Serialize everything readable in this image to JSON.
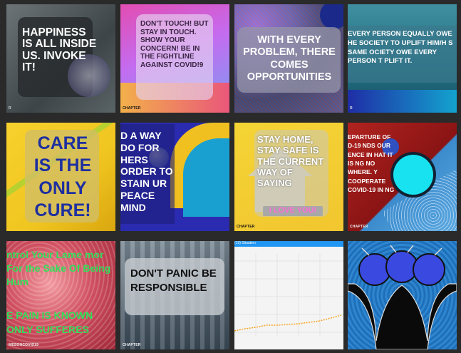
{
  "tiles": {
    "t1": {
      "text": "HAPPINESS IS ALL INSIDE US. INVOKE IT!",
      "footer": "R"
    },
    "t2": {
      "text": "DON'T TOUCH! BUT STAY IN TOUCH. SHOW YOUR CONCERN! BE IN THE FIGHTLINE AGAINST COVID!9",
      "footer": "CHAPTER"
    },
    "t3": {
      "text": "WITH EVERY PROBLEM, THERE COMES OPPORTUNITIES"
    },
    "t4": {
      "text": "EVERY PERSON EQUALLY OWE HE SOCIETY TO UPLIFT HIM/H S SAME OCIETY OWE EVERY PERSON T PLIFT IT.",
      "footer": "R"
    },
    "t5": {
      "text": "CARE IS THE ONLY CURE!"
    },
    "t6": {
      "text": "D A WAY DO FOR HERS ORDER TO STAIN UR PEACE MIND"
    },
    "t7": {
      "text": "STAY HOME, STAY SAFE IS THE CURRENT WAY OF SAYING",
      "highlight": "I LOVE YOU!",
      "footer": "CHAPTER"
    },
    "t8": {
      "text": "EPARTURE OF D-19 NDS OUR ENCE IN HAT IT IS NG NO WHERE. Y COOPERATE COVID-19 IN NG",
      "footer": "CHAPTER"
    },
    "t9": {
      "text": "ntrol Your Lame mor For the Sake Of Being Hum",
      "text2": "E PAIN IS KNOWN ONLY SUFFERES",
      "footer": "MESONCOVID19"
    },
    "t10": {
      "text": "DON'T PANIC BE RESPONSIBLE",
      "footer": "CHAPTER"
    },
    "t11": {
      "header": "(19) Situation"
    },
    "t12": {}
  },
  "colors": {
    "bg": "#2a2a2a",
    "chart_line": "#f5a623"
  }
}
